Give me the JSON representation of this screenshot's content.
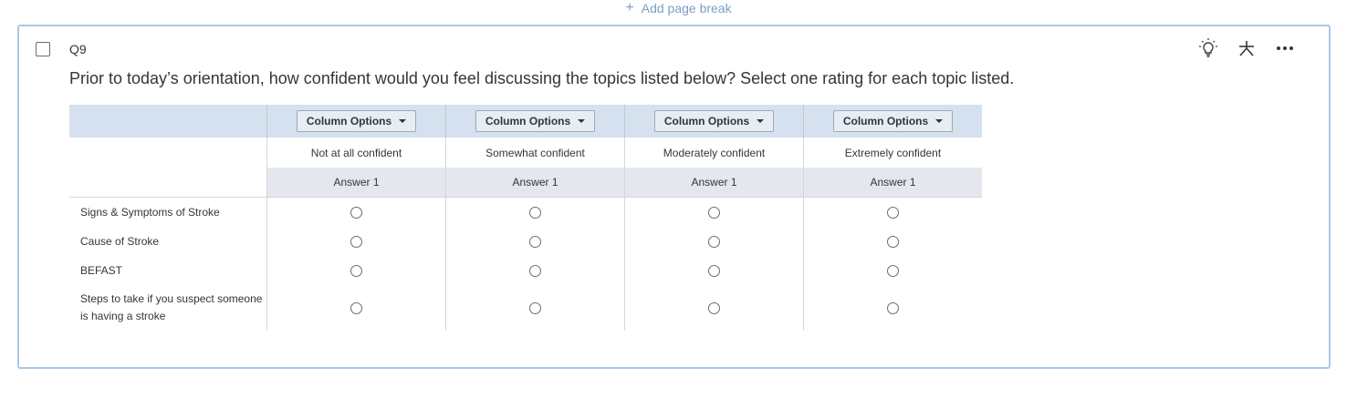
{
  "add_page_break": {
    "label": "Add page break"
  },
  "question": {
    "number": "Q9",
    "text": "Prior to today’s orientation, how confident would you feel discussing the topics listed below? Select one rating for each topic listed."
  },
  "tools": {
    "icons": [
      "lightbulb-icon",
      "asterisk-icon",
      "more-options-icon"
    ]
  },
  "matrix": {
    "column_options_label": "Column Options",
    "columns": [
      {
        "label": "Not at all confident",
        "answer": "Answer 1"
      },
      {
        "label": "Somewhat confident",
        "answer": "Answer 1"
      },
      {
        "label": "Moderately confident",
        "answer": "Answer 1"
      },
      {
        "label": "Extremely confident",
        "answer": "Answer 1"
      }
    ],
    "statements": [
      {
        "label": "Signs & Symptoms of Stroke"
      },
      {
        "label": "Cause of Stroke"
      },
      {
        "label": "BEFAST"
      },
      {
        "label": "Steps to take if you suspect someone is having a stroke"
      }
    ]
  },
  "colors": {
    "card_border": "#a9c7e6",
    "header_bg": "#d5e1ee",
    "answer_row_bg": "#e4e8ee",
    "link_color": "#7a9ec4"
  }
}
